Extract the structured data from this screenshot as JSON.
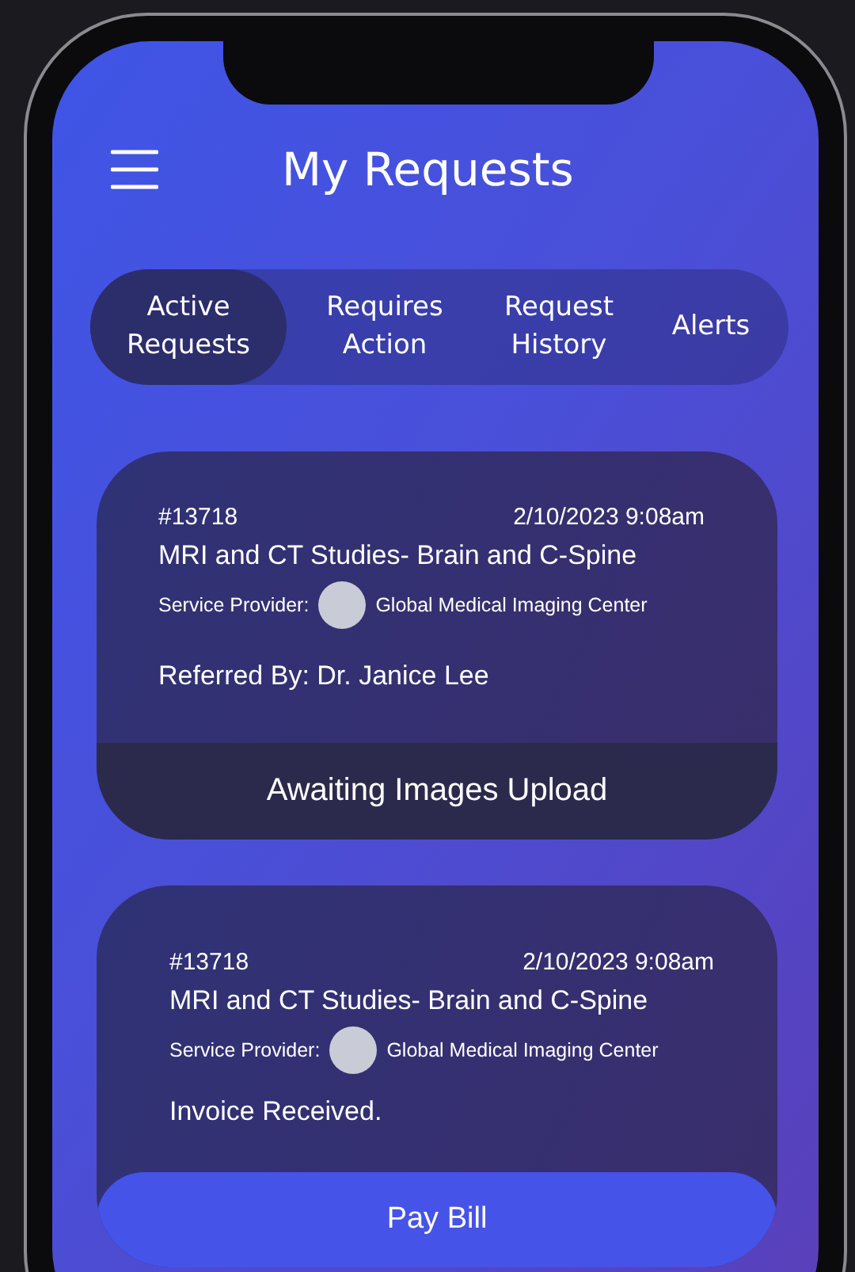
{
  "title": "My Requests",
  "tabs": [
    {
      "label": "Active Requests",
      "selected": true
    },
    {
      "label": "Requires Action",
      "selected": false
    },
    {
      "label": "Request History",
      "selected": false
    },
    {
      "label": "Alerts",
      "selected": false
    }
  ],
  "requests": [
    {
      "id": "#13718",
      "date": "2/10/2023 9:08am",
      "title": "MRI and CT Studies- Brain and C-Spine",
      "provider_label": "Service Provider:",
      "provider_name": "Global Medical Imaging Center",
      "note": "Referred By: Dr. Janice Lee",
      "action": {
        "kind": "status",
        "label": "Awaiting Images Upload"
      }
    },
    {
      "id": "#13718",
      "date": "2/10/2023 9:08am",
      "title": "MRI and CT Studies- Brain and C-Spine",
      "provider_label": "Service Provider:",
      "provider_name": "Global Medical Imaging Center",
      "note": "Invoice Received.",
      "action": {
        "kind": "button",
        "label": "Pay Bill"
      }
    }
  ]
}
